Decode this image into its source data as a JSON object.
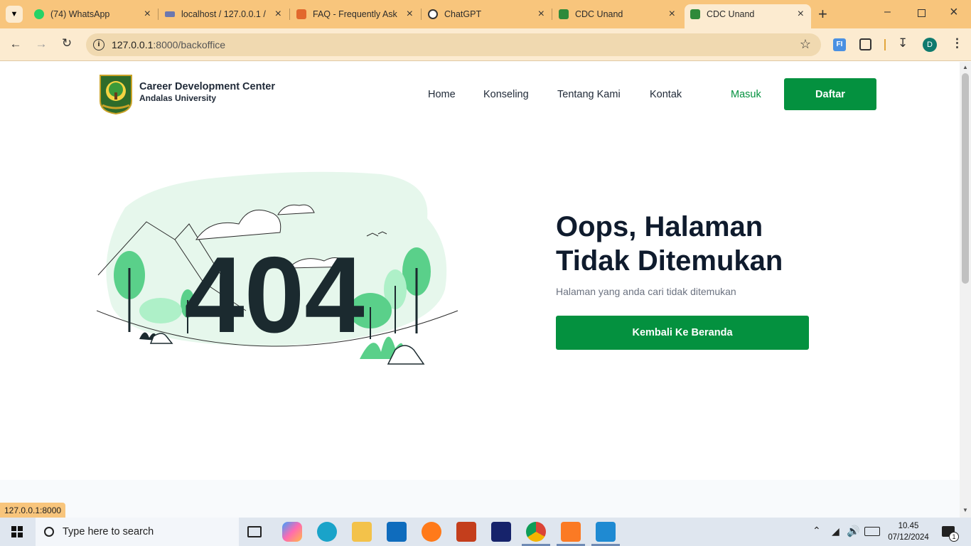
{
  "browser": {
    "tabs": [
      {
        "title": "(74) WhatsApp",
        "icon": "whatsapp-icon",
        "color": "#25d366"
      },
      {
        "title": "localhost / 127.0.0.1 / ",
        "icon": "phpmyadmin-icon",
        "color": "#6c78af"
      },
      {
        "title": "FAQ - Frequently Ask",
        "icon": "xampp-icon",
        "color": "#e2682d"
      },
      {
        "title": "ChatGPT",
        "icon": "chatgpt-icon",
        "color": "#333333"
      },
      {
        "title": "CDC Unand",
        "icon": "cdc-icon",
        "color": "#2f8a3a"
      },
      {
        "title": "CDC Unand",
        "icon": "cdc-icon",
        "color": "#2f8a3a"
      }
    ],
    "active_tab": 5,
    "url_host": "127.0.0.1",
    "url_path": ":8000/backoffice",
    "profile_initial": "D",
    "status_url": "127.0.0.1:8000"
  },
  "site": {
    "brand_line1": "Career Development Center",
    "brand_line2": "Andalas University",
    "nav": [
      "Home",
      "Konseling",
      "Tentang Kami",
      "Kontak"
    ],
    "login": "Masuk",
    "register": "Daftar",
    "accent": "#04913f"
  },
  "error": {
    "code": "404",
    "title": "Oops, Halaman Tidak Ditemukan",
    "subtitle": "Halaman yang anda cari tidak ditemukan",
    "cta": "Kembali Ke Beranda"
  },
  "taskbar": {
    "search_placeholder": "Type here to search",
    "time": "10.45",
    "date": "07/12/2024",
    "notifications": "1"
  }
}
